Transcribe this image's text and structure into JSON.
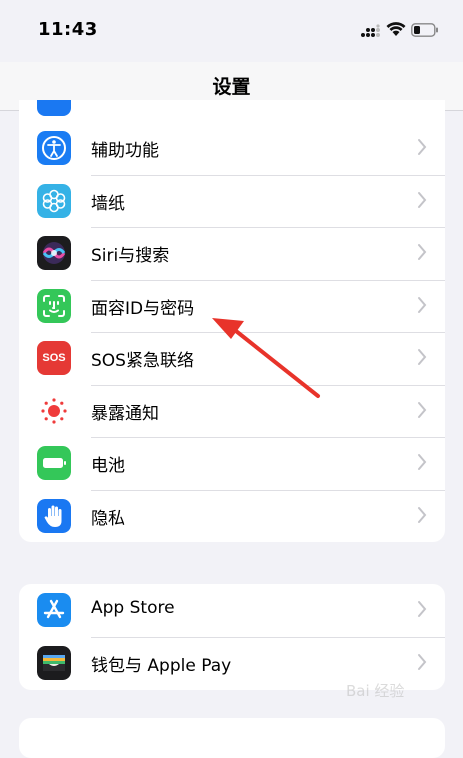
{
  "status_bar": {
    "time": "11:43"
  },
  "nav": {
    "title": "设置"
  },
  "settings_group_1": [
    {
      "label": "辅助功能",
      "icon": "accessibility-icon",
      "color": "#1a7cf3"
    },
    {
      "label": "墙纸",
      "icon": "wallpaper-flower-icon",
      "color": "#35b2e6"
    },
    {
      "label": "Siri与搜索",
      "icon": "siri-icon",
      "color": "#1c1c1e"
    },
    {
      "label": "面容ID与密码",
      "icon": "face-id-icon",
      "color": "#34c759"
    },
    {
      "label": "SOS紧急联络",
      "icon": "sos-icon",
      "color": "#e53935"
    },
    {
      "label": "暴露通知",
      "icon": "exposure-notification-icon",
      "color": "#ffffff"
    },
    {
      "label": "电池",
      "icon": "battery-icon",
      "color": "#34c759"
    },
    {
      "label": "隐私",
      "icon": "privacy-hand-icon",
      "color": "#1a78f2"
    }
  ],
  "settings_group_2": [
    {
      "label": "App Store",
      "icon": "app-store-icon",
      "color": "#1a8cf0"
    },
    {
      "label": "钱包与 Apple Pay",
      "icon": "wallet-icon",
      "color": "#1c1c1e"
    }
  ],
  "sos_icon_text": "SOS",
  "watermark": "Bai 经验",
  "annotation_color": "#e8332a"
}
